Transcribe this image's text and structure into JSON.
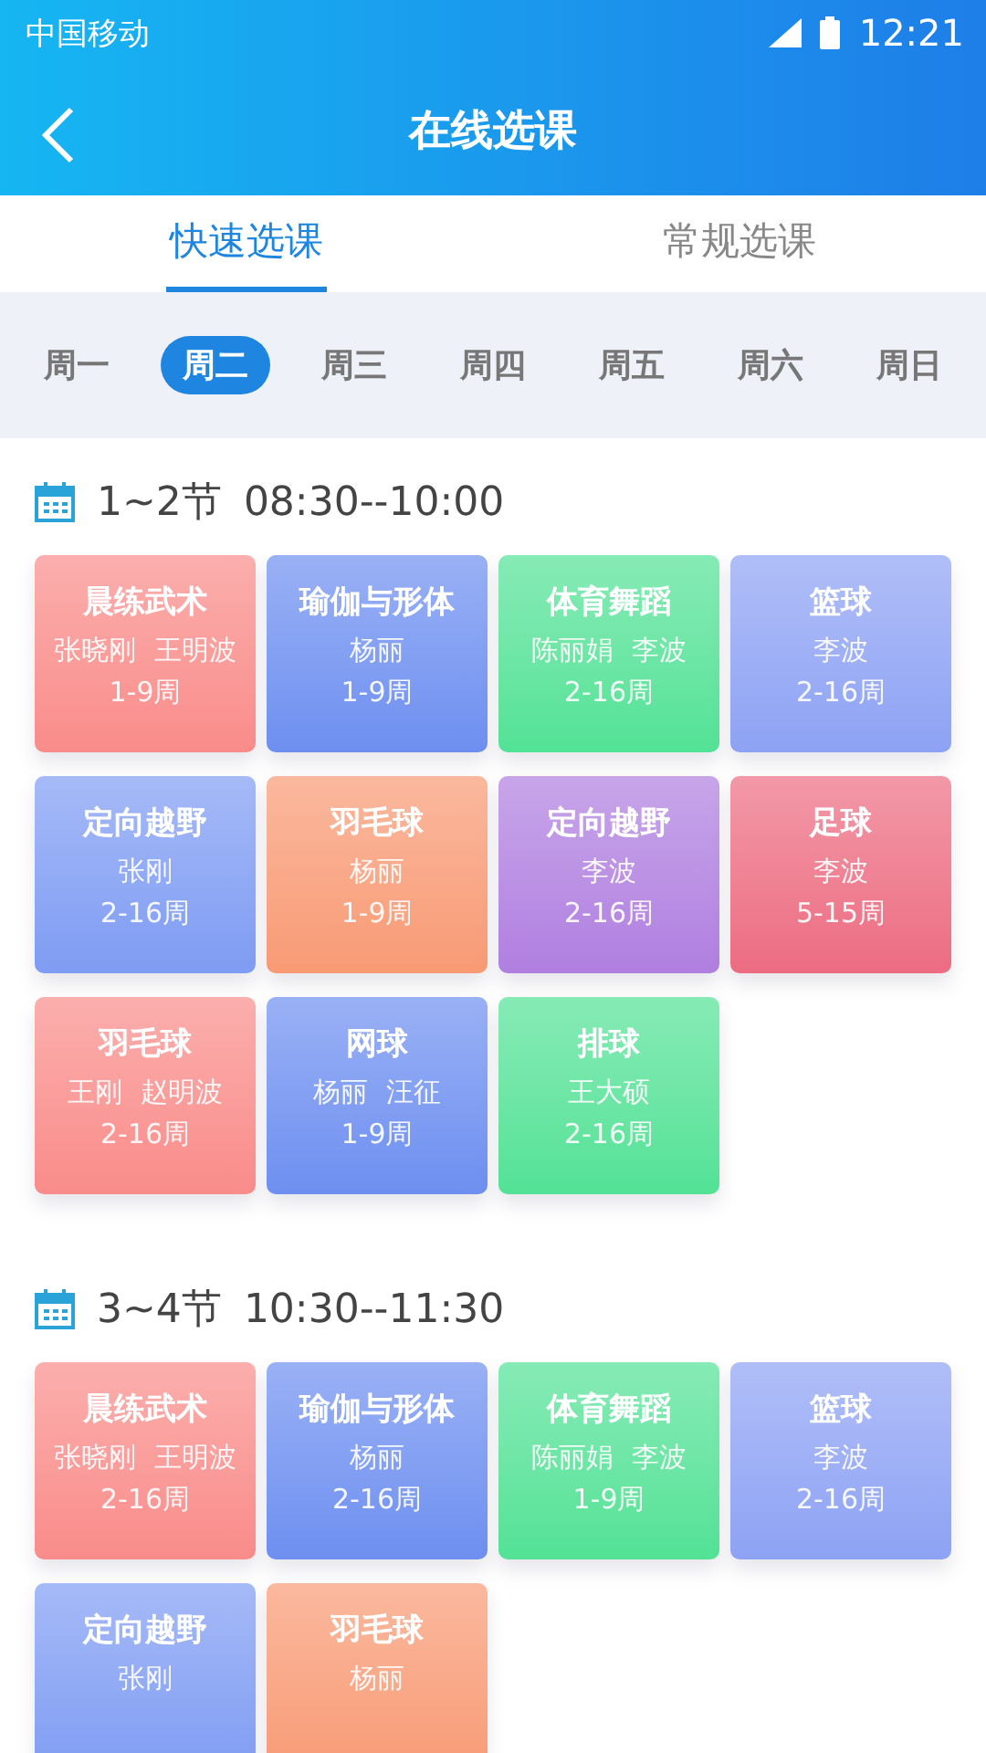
{
  "status_bar": {
    "carrier": "中国移动",
    "time": "12:21"
  },
  "header": {
    "title": "在线选课"
  },
  "tabs": [
    {
      "label": "快速选课",
      "selected": true
    },
    {
      "label": "常规选课",
      "selected": false
    }
  ],
  "days": [
    {
      "label": "周一",
      "selected": false
    },
    {
      "label": "周二",
      "selected": true
    },
    {
      "label": "周三",
      "selected": false
    },
    {
      "label": "周四",
      "selected": false
    },
    {
      "label": "周五",
      "selected": false
    },
    {
      "label": "周六",
      "selected": false
    },
    {
      "label": "周日",
      "selected": false
    }
  ],
  "sections": [
    {
      "period": "1~2节",
      "time": "08:30--10:00",
      "courses": [
        {
          "name": "晨练武术",
          "teachers": "张晓刚  王明波",
          "weeks": "1-9周",
          "color": "#f98c8a"
        },
        {
          "name": "瑜伽与形体",
          "teachers": "杨丽",
          "weeks": "1-9周",
          "color": "#6e8ff0"
        },
        {
          "name": "体育舞蹈",
          "teachers": "陈丽娟  李波",
          "weeks": "2-16周",
          "color": "#52e296"
        },
        {
          "name": "篮球",
          "teachers": "李波",
          "weeks": "2-16周",
          "color": "#8ea2f4"
        },
        {
          "name": "定向越野",
          "teachers": "张刚",
          "weeks": "2-16周",
          "color": "#7f9cf3"
        },
        {
          "name": "羽毛球",
          "teachers": "杨丽",
          "weeks": "1-9周",
          "color": "#f89a74"
        },
        {
          "name": "定向越野",
          "teachers": "李波",
          "weeks": "2-16周",
          "color": "#b07fe0"
        },
        {
          "name": "足球",
          "teachers": "李波",
          "weeks": "5-15周",
          "color": "#ec6c82"
        },
        {
          "name": "羽毛球",
          "teachers": "王刚  赵明波",
          "weeks": "2-16周",
          "color": "#f98c8a"
        },
        {
          "name": "网球",
          "teachers": "杨丽  汪征",
          "weeks": "1-9周",
          "color": "#6e8ff0"
        },
        {
          "name": "排球",
          "teachers": "王大硕",
          "weeks": "2-16周",
          "color": "#52e296"
        }
      ]
    },
    {
      "period": "3~4节",
      "time": "10:30--11:30",
      "courses": [
        {
          "name": "晨练武术",
          "teachers": "张晓刚  王明波",
          "weeks": "2-16周",
          "color": "#f98c8a"
        },
        {
          "name": "瑜伽与形体",
          "teachers": "杨丽",
          "weeks": "2-16周",
          "color": "#6e8ff0"
        },
        {
          "name": "体育舞蹈",
          "teachers": "陈丽娟  李波",
          "weeks": "1-9周",
          "color": "#52e296"
        },
        {
          "name": "篮球",
          "teachers": "李波",
          "weeks": "2-16周",
          "color": "#8ea2f4"
        },
        {
          "name": "定向越野",
          "teachers": "张刚",
          "color": "#7f9cf3"
        },
        {
          "name": "羽毛球",
          "teachers": "杨丽",
          "color": "#f89a74"
        }
      ]
    }
  ]
}
